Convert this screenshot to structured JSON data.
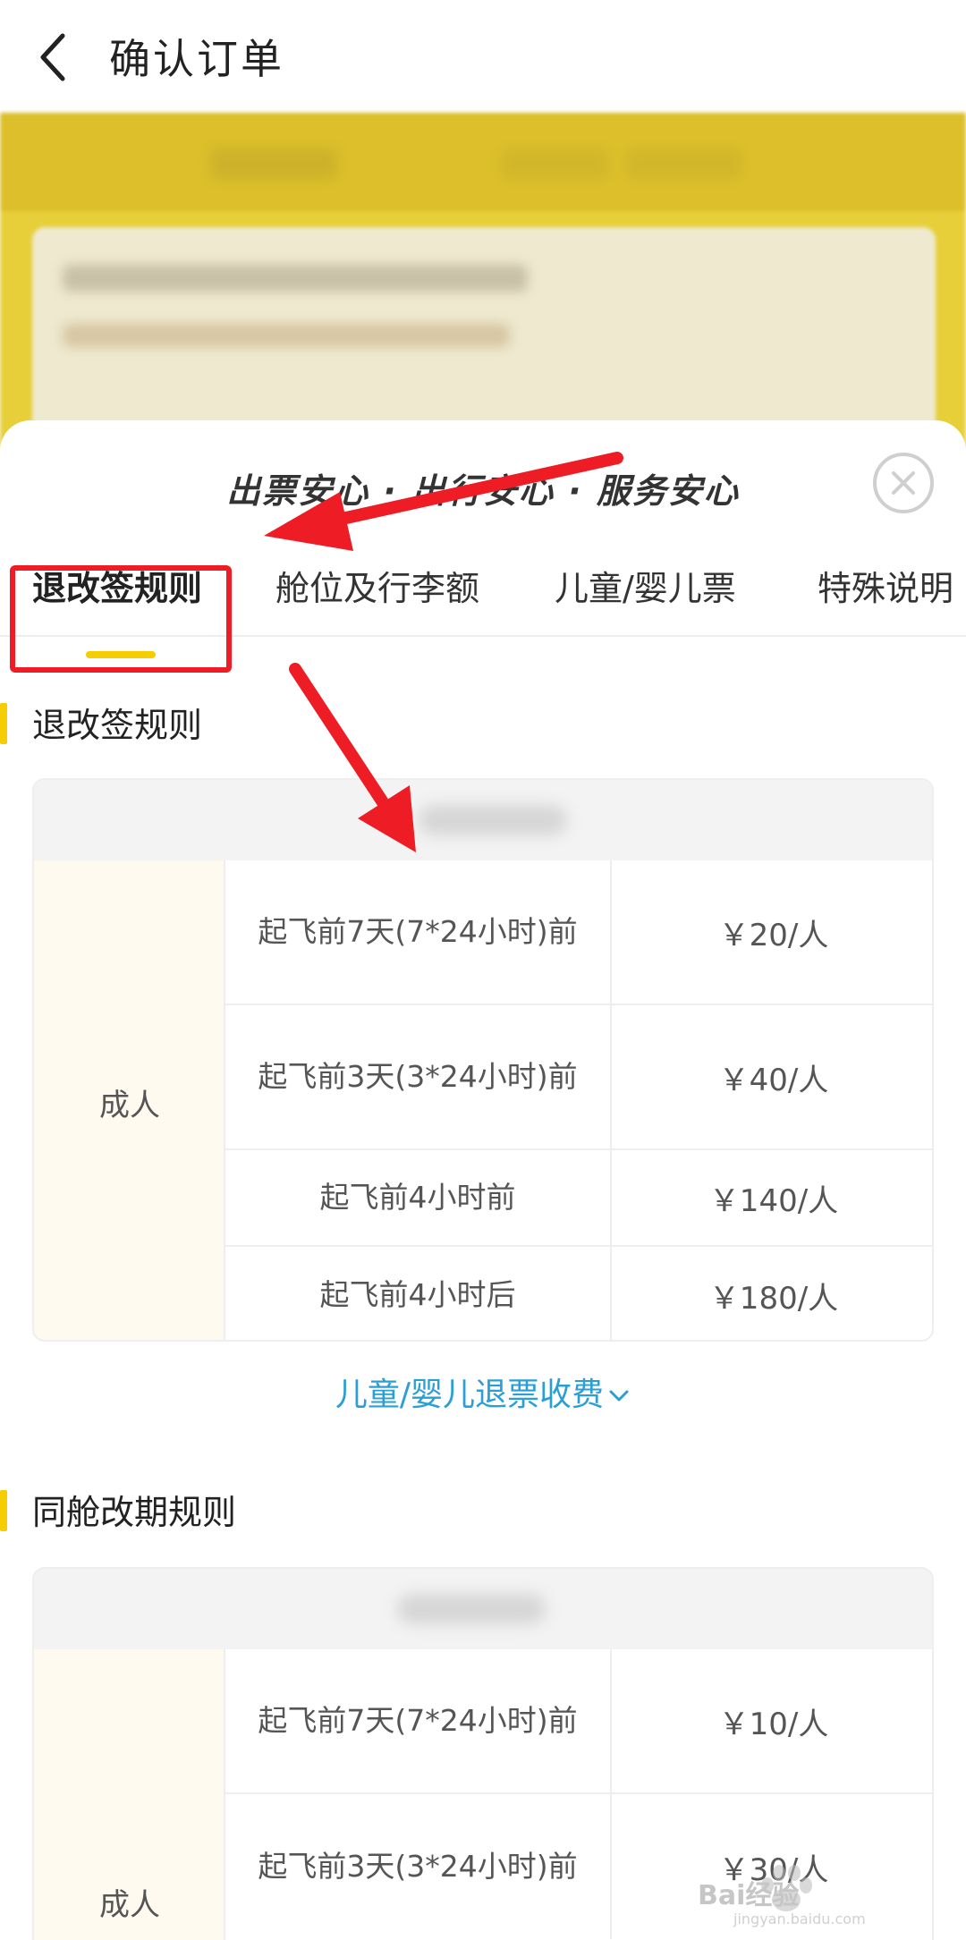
{
  "header": {
    "title": "确认订单"
  },
  "sheet": {
    "slogan": "出票安心 · 出行安心 · 服务安心",
    "tabs": [
      "退改签规则",
      "舱位及行李额",
      "儿童/婴儿票",
      "特殊说明"
    ]
  },
  "refund_section": {
    "title": "退改签规则",
    "passenger_type": "成人",
    "rows": [
      {
        "condition": "起飞前7天(7*24小时)前",
        "fee": "￥20/人"
      },
      {
        "condition": "起飞前3天(3*24小时)前",
        "fee": "￥40/人"
      },
      {
        "condition": "起飞前4小时前",
        "fee": "￥140/人"
      },
      {
        "condition": "起飞前4小时后",
        "fee": "￥180/人"
      }
    ],
    "child_fee_link": "儿童/婴儿退票收费"
  },
  "change_section": {
    "title": "同舱改期规则",
    "passenger_type": "成人",
    "rows": [
      {
        "condition": "起飞前7天(7*24小时)前",
        "fee": "￥10/人"
      },
      {
        "condition": "起飞前3天(3*24小时)前",
        "fee": "￥30/人"
      }
    ]
  },
  "watermark": {
    "brand": "Bai经验",
    "url": "jingyan.baidu.com"
  },
  "colors": {
    "accent": "#f5cd00",
    "link": "#2a9fd6",
    "annotation": "#ee1c25"
  }
}
